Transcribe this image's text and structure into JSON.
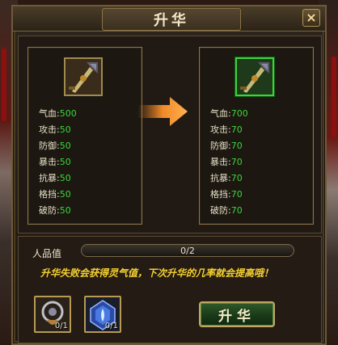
{
  "window": {
    "title": "升华",
    "close_symbol": "×"
  },
  "current": {
    "stats": [
      {
        "name": "气血:",
        "value": "500"
      },
      {
        "name": "攻击:",
        "value": "50"
      },
      {
        "name": "防御:",
        "value": "50"
      },
      {
        "name": "暴击:",
        "value": "50"
      },
      {
        "name": "抗暴:",
        "value": "50"
      },
      {
        "name": "格挡:",
        "value": "50"
      },
      {
        "name": "破防:",
        "value": "50"
      }
    ]
  },
  "next": {
    "stats": [
      {
        "name": "气血:",
        "value": "700"
      },
      {
        "name": "攻击:",
        "value": "70"
      },
      {
        "name": "防御:",
        "value": "70"
      },
      {
        "name": "暴击:",
        "value": "70"
      },
      {
        "name": "抗暴:",
        "value": "70"
      },
      {
        "name": "格挡:",
        "value": "70"
      },
      {
        "name": "破防:",
        "value": "70"
      }
    ]
  },
  "renpin": {
    "label": "人品值",
    "value_text": "0/2",
    "fraction": 0
  },
  "hint": "升华失败会获得灵气值，下次升华的几率就会提高哦！",
  "materials": [
    {
      "icon": "amulet-icon",
      "count": "0/1"
    },
    {
      "icon": "blue-gem-icon",
      "count": "0/1"
    }
  ],
  "upgrade_button": "升华",
  "colors": {
    "stat_value": "#38d838",
    "hint": "#f5d030",
    "frame": "#8c7446"
  }
}
